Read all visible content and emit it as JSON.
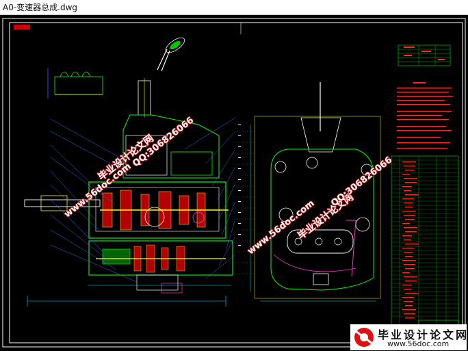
{
  "window": {
    "title": "A0-变速器总成.dwg"
  },
  "colors": {
    "background": "#000000",
    "frame": "#ffffff",
    "outline": "#00ff00",
    "part": "#ffff00",
    "dimension": "#00e5ff",
    "leader": "#3a6cff",
    "table_red": "#ff2a2a",
    "table_green": "#00c800",
    "watermark_red": "#e01010",
    "watermark_fill": "#ffffff"
  },
  "watermarks": {
    "site_name": "毕业设计论文网",
    "site_url": "www.56doc.com",
    "qq": "QQ:306826066"
  },
  "footer_logo": {
    "name": "毕业设计论文网",
    "url": "www.56doc.com"
  }
}
